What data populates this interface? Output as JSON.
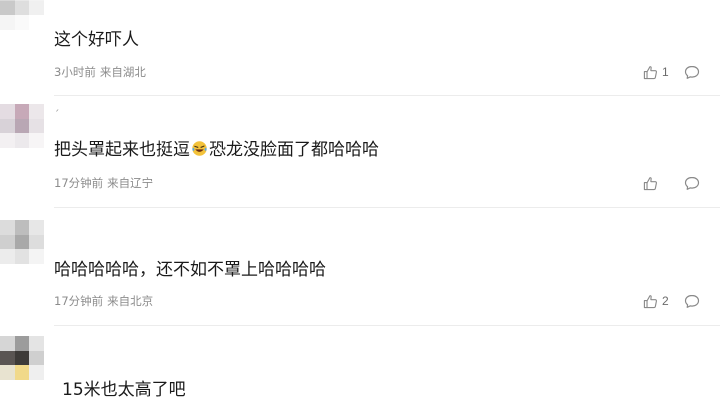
{
  "comments": [
    {
      "nickname": "",
      "text": "这个好吓人",
      "time": "3小时前",
      "location": "来自湖北",
      "likes": "1"
    },
    {
      "nickname": "ˊ",
      "text_before": "把头罩起来也挺逗",
      "emoji": "laughing-crying-emoji",
      "text_after": "恐龙没脸面了都哈哈哈",
      "time": "17分钟前",
      "location": "来自辽宁",
      "likes": ""
    },
    {
      "nickname": "",
      "text": "哈哈哈哈哈，还不如不罩上哈哈哈哈",
      "time": "17分钟前",
      "location": "来自北京",
      "likes": "2"
    },
    {
      "nickname": "",
      "text": "15米也太高了吧",
      "time": "",
      "location": "",
      "likes": ""
    }
  ],
  "icons": {
    "like": "thumbs-up-icon",
    "reply": "comment-bubble-icon"
  },
  "colors": {
    "text": "#1a1a1a",
    "meta": "#8c8c8c",
    "icon": "#8a8a8a",
    "divider": "#ececec"
  }
}
